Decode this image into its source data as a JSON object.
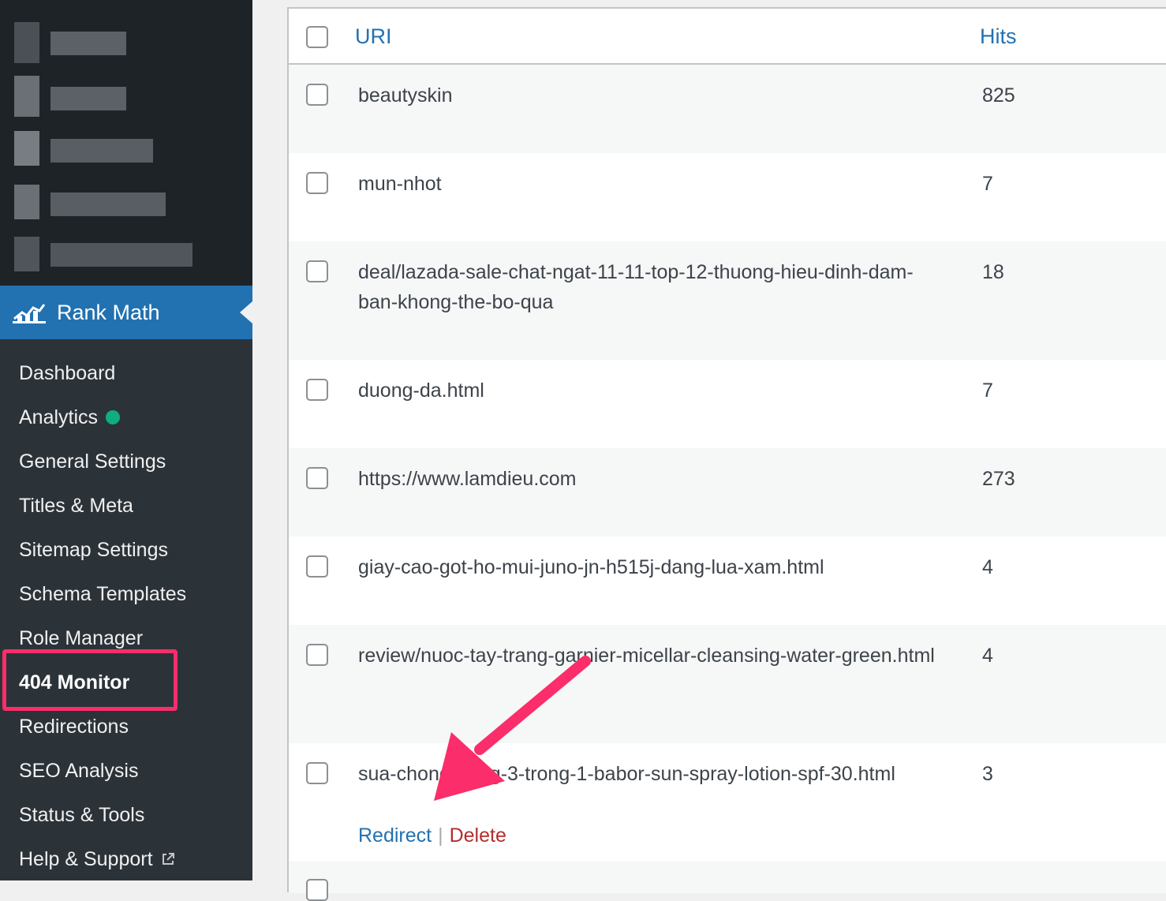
{
  "sidebar": {
    "plugin_title": "Rank Math",
    "plugin_icon": "rank-math-logo-icon",
    "items": [
      {
        "label": "Dashboard"
      },
      {
        "label": "Analytics",
        "status_dot_color": "#10ac84"
      },
      {
        "label": "General Settings"
      },
      {
        "label": "Titles & Meta"
      },
      {
        "label": "Sitemap Settings"
      },
      {
        "label": "Schema Templates"
      },
      {
        "label": "Role Manager"
      },
      {
        "label": "404 Monitor",
        "current": true
      },
      {
        "label": "Redirections"
      },
      {
        "label": "SEO Analysis"
      },
      {
        "label": "Status & Tools"
      },
      {
        "label": "Help & Support",
        "icon": "external-link-icon"
      }
    ]
  },
  "table": {
    "headers": {
      "uri": "URI",
      "hits": "Hits"
    },
    "rows": [
      {
        "uri": "beautyskin",
        "hits": "825"
      },
      {
        "uri": "mun-nhot",
        "hits": "7"
      },
      {
        "uri": "deal/lazada-sale-chat-ngat-11-11-top-12-thuong-hieu-dinh-dam-ban-khong-the-bo-qua",
        "hits": "18"
      },
      {
        "uri": "duong-da.html",
        "hits": "7"
      },
      {
        "uri": "https://www.lamdieu.com",
        "hits": "273"
      },
      {
        "uri": "giay-cao-got-ho-mui-juno-jn-h515j-dang-lua-xam.html",
        "hits": "4"
      },
      {
        "uri": "review/nuoc-tay-trang-garnier-micellar-cleansing-water-green.html",
        "hits": "4"
      },
      {
        "uri": "sua-chong-nang-3-trong-1-babor-sun-spray-lotion-spf-30.html",
        "hits": "3",
        "actions": {
          "redirect": "Redirect",
          "separator": "|",
          "delete": "Delete"
        }
      }
    ]
  },
  "annotations": {
    "highlight_color": "#fb2d6a",
    "arrow_color": "#fb2d6a"
  }
}
